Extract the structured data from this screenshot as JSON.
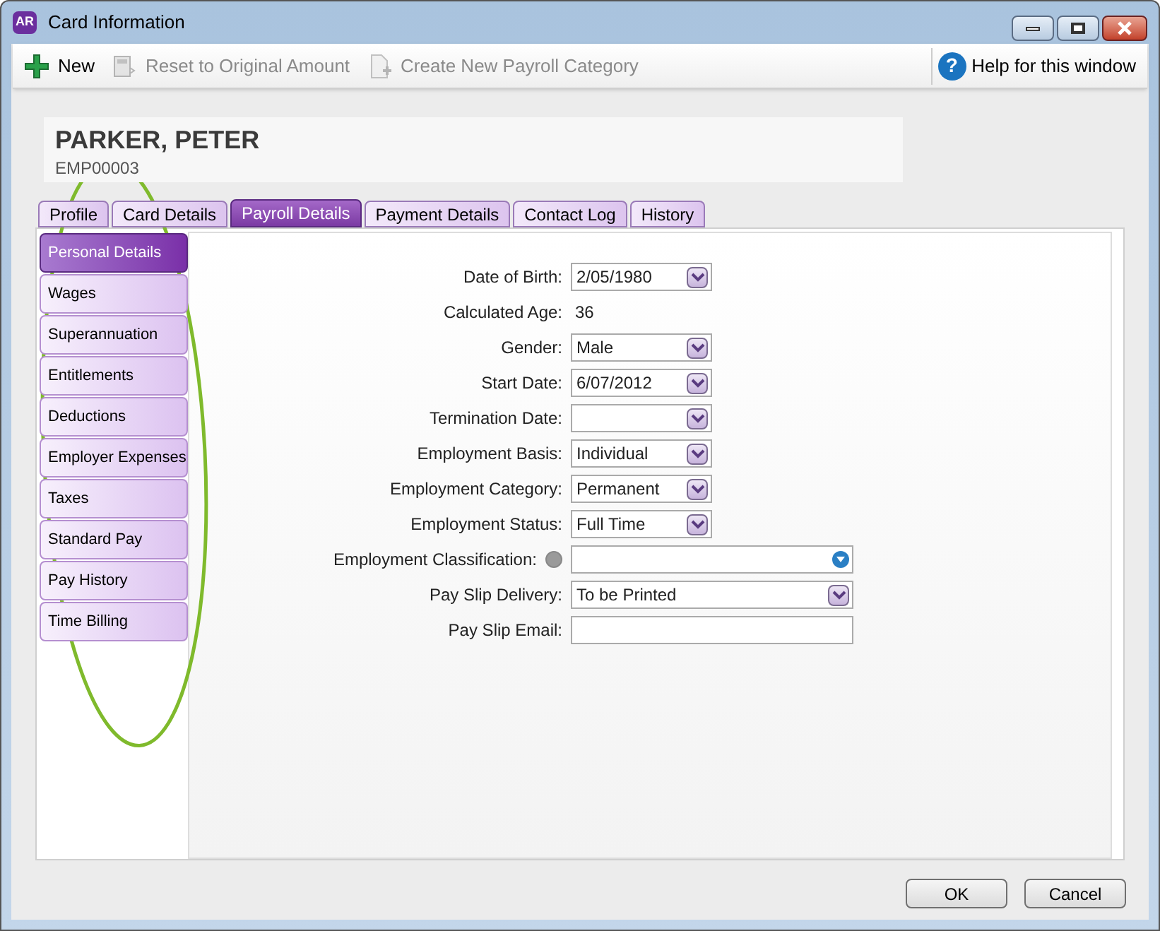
{
  "window": {
    "logo": "AR",
    "title": "Card Information"
  },
  "toolbar": {
    "items": [
      {
        "label": "New",
        "kind": "new",
        "disabled": false
      },
      {
        "label": "Reset to Original Amount",
        "kind": "reset",
        "disabled": true
      },
      {
        "label": "Create New Payroll Category",
        "kind": "create",
        "disabled": true
      }
    ],
    "help_icon": "?",
    "help": "Help for this window"
  },
  "employee": {
    "name": "PARKER, PETER",
    "id": "EMP00003"
  },
  "tabs": [
    {
      "label": "Profile",
      "selected": false
    },
    {
      "label": "Card Details",
      "selected": false
    },
    {
      "label": "Payroll Details",
      "selected": true
    },
    {
      "label": "Payment Details",
      "selected": false
    },
    {
      "label": "Contact Log",
      "selected": false
    },
    {
      "label": "History",
      "selected": false
    }
  ],
  "side_nav": [
    {
      "label": "Personal Details",
      "selected": true
    },
    {
      "label": "Wages",
      "selected": false
    },
    {
      "label": "Superannuation",
      "selected": false
    },
    {
      "label": "Entitlements",
      "selected": false
    },
    {
      "label": "Deductions",
      "selected": false
    },
    {
      "label": "Employer Expenses",
      "selected": false
    },
    {
      "label": "Taxes",
      "selected": false
    },
    {
      "label": "Standard Pay",
      "selected": false
    },
    {
      "label": "Pay History",
      "selected": false
    },
    {
      "label": "Time Billing",
      "selected": false
    }
  ],
  "form": {
    "fields": [
      {
        "label": "Date of Birth:",
        "kind": "dropdown",
        "value": "2/05/1980",
        "wide": false
      },
      {
        "label": "Calculated Age:",
        "kind": "readonly",
        "value": "36"
      },
      {
        "label": "Gender:",
        "kind": "dropdown",
        "value": "Male",
        "wide": false
      },
      {
        "label": "Start Date:",
        "kind": "dropdown",
        "value": "6/07/2012",
        "wide": false
      },
      {
        "label": "Termination Date:",
        "kind": "dropdown",
        "wide": false
      },
      {
        "label": "Employment Basis:",
        "kind": "dropdown",
        "value": "Individual",
        "wide": false
      },
      {
        "label": "Employment Category:",
        "kind": "dropdown",
        "value": "Permanent",
        "wide": false
      },
      {
        "label": "Employment Status:",
        "kind": "dropdown",
        "value": "Full Time",
        "wide": false
      },
      {
        "label": "Employment Classification:",
        "kind": "lookup",
        "wide": true
      },
      {
        "label": "Pay Slip Delivery:",
        "kind": "dropdown",
        "value": "To be Printed",
        "wide": true
      },
      {
        "label": "Pay Slip Email:",
        "kind": "text",
        "wide": true
      }
    ]
  },
  "buttons": [
    "OK",
    "Cancel"
  ]
}
